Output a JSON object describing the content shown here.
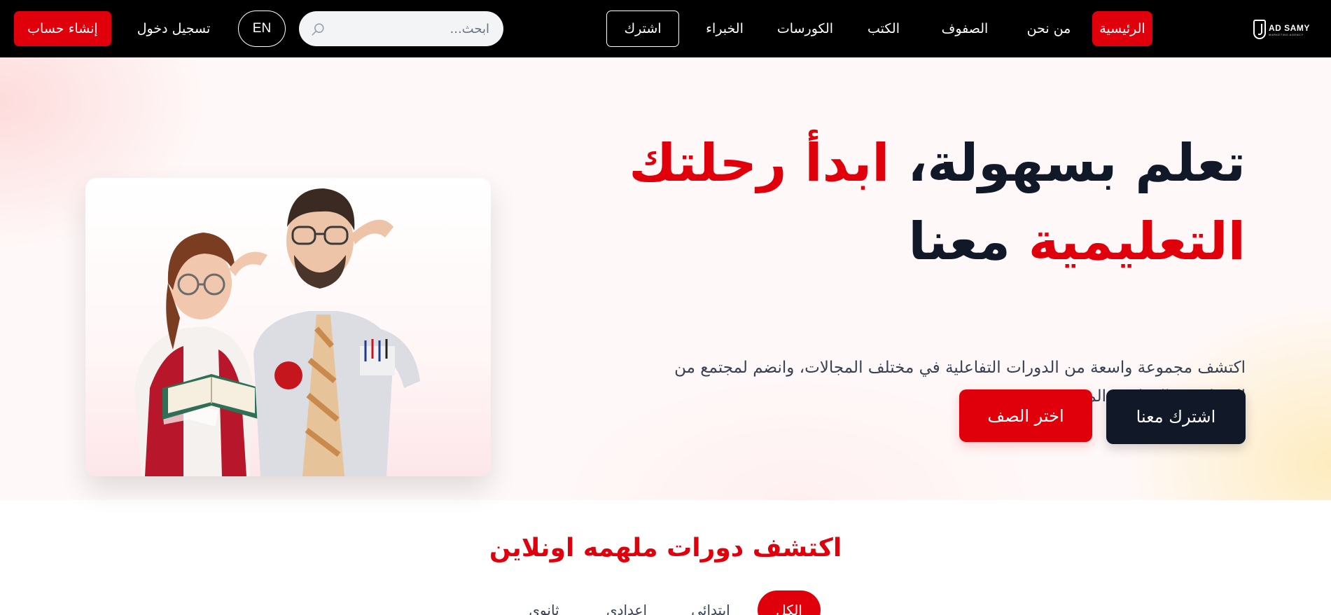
{
  "brand": {
    "logo_text": "AD SAMY",
    "logo_sub": "MARKETING AGENCY"
  },
  "nav": {
    "home": "الرئيسية",
    "about": "من نحن",
    "grades": "الصفوف",
    "books": "الكتب",
    "courses": "الكورسات",
    "experts": "الخبراء",
    "subscribe": "اشترك"
  },
  "search": {
    "placeholder": "ابحث..."
  },
  "auth": {
    "language": "EN",
    "login": "تسجيل دخول",
    "signup": "إنشاء حساب"
  },
  "hero": {
    "title_part1": "تعلم بسهولة، ",
    "title_accent1": "ابدأ رحلتك",
    "title_accent2": "التعليمية",
    "title_part2": " معنا",
    "description": "اكتشف مجموعة واسعة من الدورات التفاعلية في مختلف المجالات، وانضم لمجتمع من المتعلمين والمعلمين المميزين",
    "btn_join": "اشترك معنا",
    "btn_choose_grade": "اختر الصف"
  },
  "courses": {
    "title": "اكتشف دورات ملهمه اونلاين",
    "filters": [
      "الكل",
      "ابتدائي",
      "اعدادي",
      "ثانوي"
    ],
    "active_filter": "الكل"
  },
  "colors": {
    "brand_red": "#e0000b",
    "navbar_bg": "#000000",
    "dark_button": "#111827"
  }
}
